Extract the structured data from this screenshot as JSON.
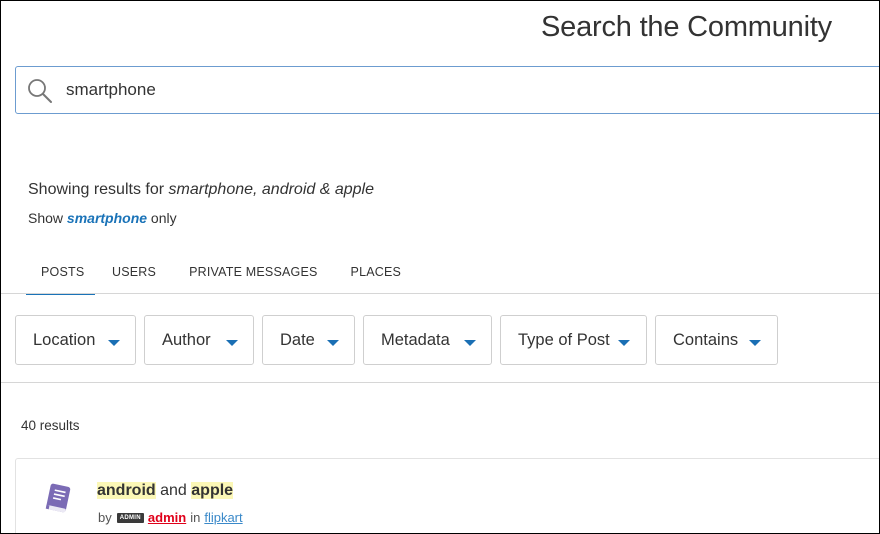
{
  "page": {
    "title": "Search the Community"
  },
  "search": {
    "value": "smartphone",
    "icon": "search-icon"
  },
  "results_for": {
    "prefix": "Showing results for ",
    "terms": "smartphone, android & apple",
    "show_prefix": "Show ",
    "show_term": "smartphone",
    "show_suffix": " only"
  },
  "tabs": [
    {
      "label": "POSTS",
      "active": true
    },
    {
      "label": "USERS",
      "active": false
    },
    {
      "label": "PRIVATE MESSAGES",
      "active": false
    },
    {
      "label": "PLACES",
      "active": false
    }
  ],
  "filters": [
    {
      "label": "Location"
    },
    {
      "label": "Author"
    },
    {
      "label": "Date"
    },
    {
      "label": "Metadata"
    },
    {
      "label": "Type of Post"
    },
    {
      "label": "Contains"
    }
  ],
  "results": {
    "count_label": "40 results",
    "items": [
      {
        "icon": "book-icon",
        "title_term1": "android",
        "title_join": " and ",
        "title_term2": "apple",
        "by_label": "by",
        "badge": "ADMIN",
        "author": "admin",
        "in_label": "in",
        "board": "flipkart"
      }
    ]
  },
  "colors": {
    "accent": "#1a73b8",
    "highlight": "#fbf7b6",
    "author_red": "#e0001a",
    "icon_purple": "#7b6bb5"
  }
}
